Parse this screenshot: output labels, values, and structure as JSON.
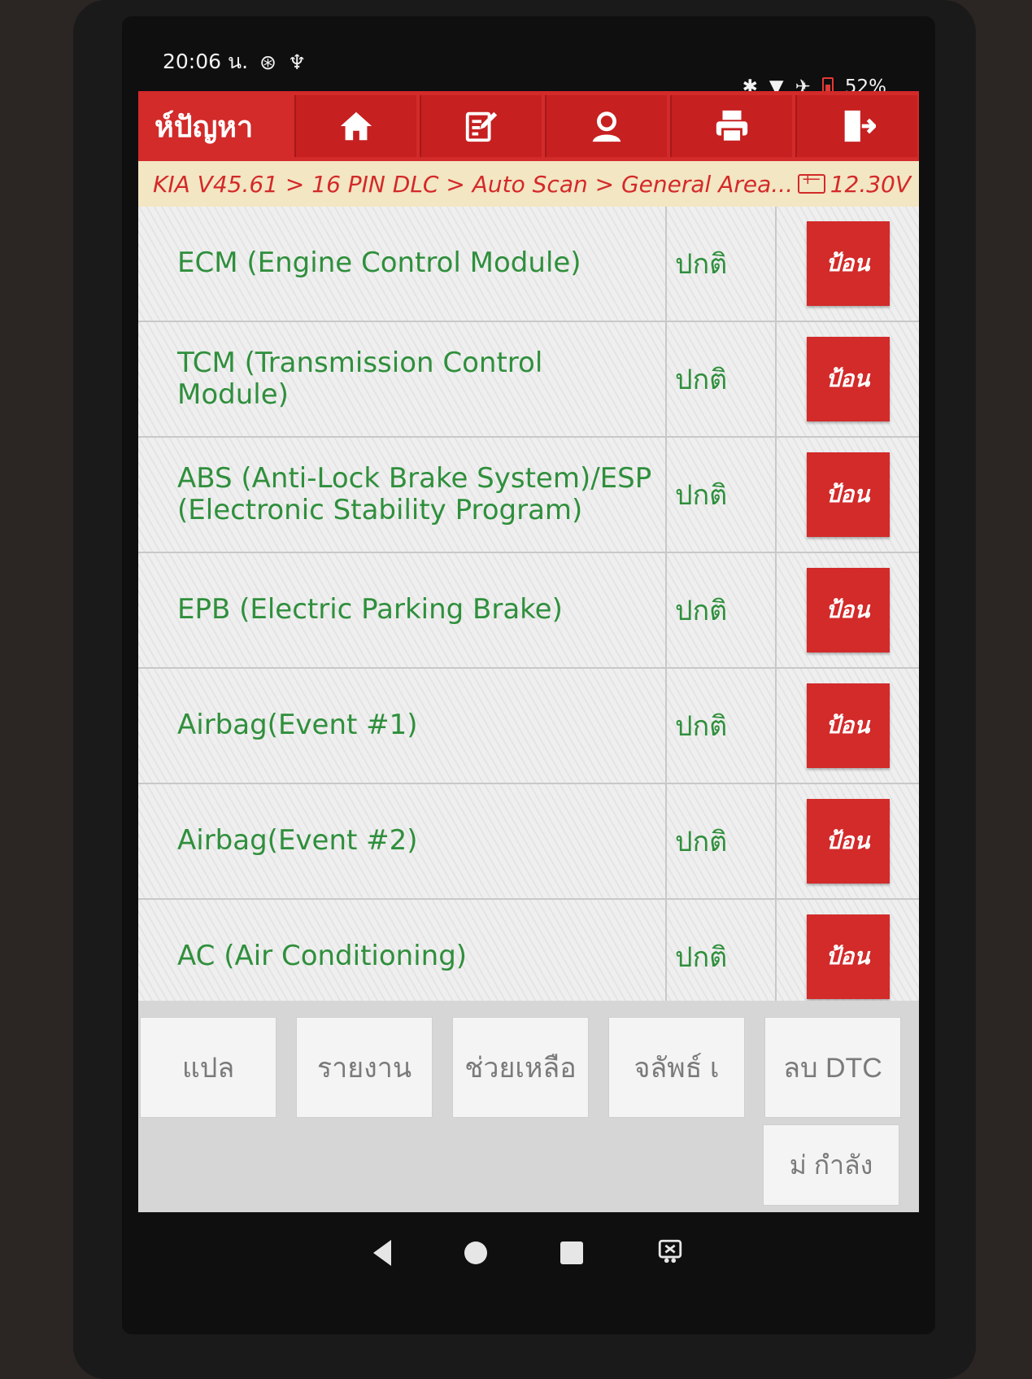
{
  "statusbar": {
    "time": "20:06 น.",
    "battery_percent": "52%"
  },
  "toolbar": {
    "title": "ห์ปัญหา",
    "icons": [
      "home-icon",
      "edit-icon",
      "support-icon",
      "print-icon",
      "exit-icon"
    ]
  },
  "breadcrumb": {
    "path": "KIA V45.61 > 16 PIN DLC > Auto Scan > General Area...",
    "voltage": "12.30V"
  },
  "modules": [
    {
      "name": "ECM (Engine Control Module)",
      "status": "ปกติ",
      "action": "ป้อน"
    },
    {
      "name": "TCM (Transmission Control Module)",
      "status": "ปกติ",
      "action": "ป้อน"
    },
    {
      "name": "ABS (Anti-Lock Brake System)/ESP (Electronic Stability Program)",
      "status": "ปกติ",
      "action": "ป้อน"
    },
    {
      "name": "EPB (Electric Parking Brake)",
      "status": "ปกติ",
      "action": "ป้อน"
    },
    {
      "name": "Airbag(Event #1)",
      "status": "ปกติ",
      "action": "ป้อน"
    },
    {
      "name": "Airbag(Event #2)",
      "status": "ปกติ",
      "action": "ป้อน"
    },
    {
      "name": "AC (Air Conditioning)",
      "status": "ปกติ",
      "action": "ป้อน"
    }
  ],
  "bottom_buttons": {
    "translate": "แปล",
    "report": "รายงาน",
    "help": "ช่วยเหลือ",
    "record": "จลัพธ์ เ",
    "clear_dtc": "ลบ DTC",
    "more": "ม่   กำลัง"
  },
  "colors": {
    "accent": "#d32a2a",
    "ok_text": "#2f8f3c",
    "breadcrumb_bg": "#f3e6c2"
  }
}
